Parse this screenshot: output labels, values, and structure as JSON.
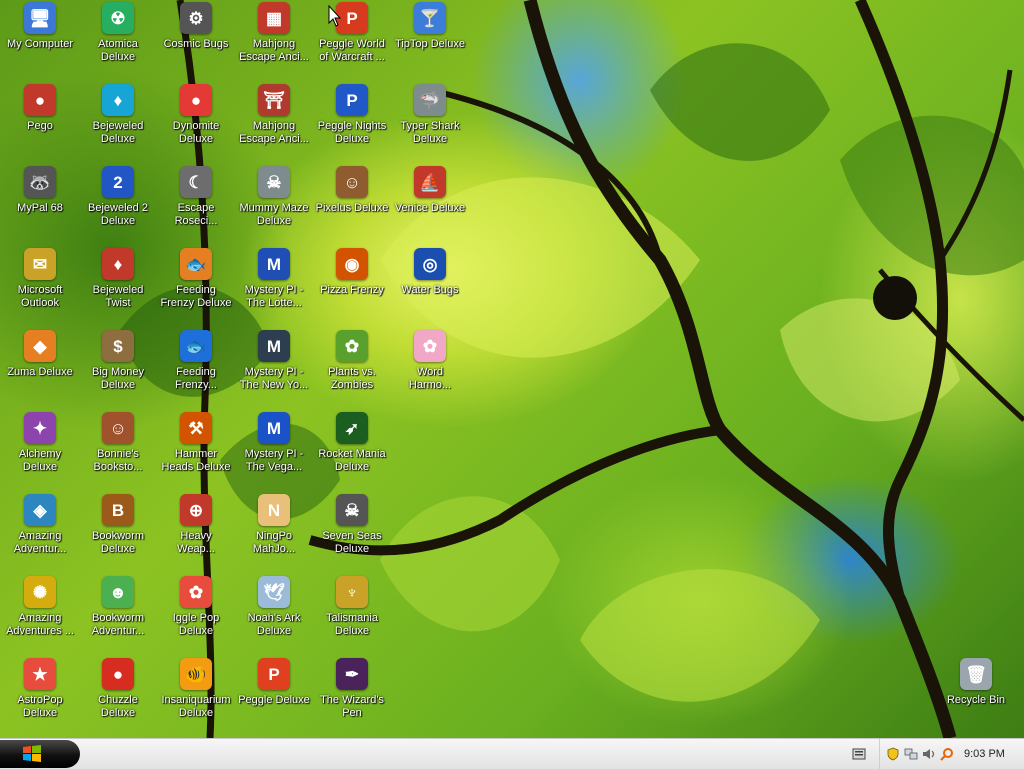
{
  "desktop": {
    "icons": [
      {
        "label": "My Computer",
        "name": "my-computer-icon",
        "color": "#3c78d8",
        "glyph": "🖥"
      },
      {
        "label": "Pego",
        "name": "pego-icon",
        "color": "#c0392b",
        "glyph": "●"
      },
      {
        "label": "MyPal 68",
        "name": "mypal-icon",
        "color": "#555555",
        "glyph": "🦝"
      },
      {
        "label": "Microsoft\nOutlook",
        "name": "outlook-icon",
        "color": "#c9a227",
        "glyph": "✉"
      },
      {
        "label": "Zuma Deluxe",
        "name": "zuma-icon",
        "color": "#e67e22",
        "glyph": "◆"
      },
      {
        "label": "Alchemy\nDeluxe",
        "name": "alchemy-icon",
        "color": "#8e44ad",
        "glyph": "✦"
      },
      {
        "label": "Amazing\nAdventur...",
        "name": "amazing-adventures-1-icon",
        "color": "#2e86c1",
        "glyph": "◈"
      },
      {
        "label": "Amazing\nAdventures ...",
        "name": "amazing-adventures-2-icon",
        "color": "#d4ac0d",
        "glyph": "✺"
      },
      {
        "label": "AstroPop\nDeluxe",
        "name": "astropop-icon",
        "color": "#e74c3c",
        "glyph": "★"
      },
      {
        "label": "Atomica\nDeluxe",
        "name": "atomica-icon",
        "color": "#27ae60",
        "glyph": "☢"
      },
      {
        "label": "Bejeweled\nDeluxe",
        "name": "bejeweled-icon",
        "color": "#17a5d6",
        "glyph": "♦"
      },
      {
        "label": "Bejeweled 2\nDeluxe",
        "name": "bejeweled-2-icon",
        "color": "#2256c4",
        "glyph": "2"
      },
      {
        "label": "Bejeweled\nTwist",
        "name": "bejeweled-twist-icon",
        "color": "#c0392b",
        "glyph": "♦"
      },
      {
        "label": "Big Money\nDeluxe",
        "name": "big-money-icon",
        "color": "#8d6e3f",
        "glyph": "$"
      },
      {
        "label": "Bonnie's\nBooksto...",
        "name": "bonnies-bookstore-icon",
        "color": "#a0522d",
        "glyph": "☺"
      },
      {
        "label": "Bookworm\nDeluxe",
        "name": "bookworm-icon",
        "color": "#9c5a1a",
        "glyph": "B"
      },
      {
        "label": "Bookworm\nAdventur...",
        "name": "bookworm-adventures-icon",
        "color": "#4caf50",
        "glyph": "☻"
      },
      {
        "label": "Chuzzle\nDeluxe",
        "name": "chuzzle-icon",
        "color": "#d62d20",
        "glyph": "●"
      },
      {
        "label": "Cosmic Bugs",
        "name": "cosmic-bugs-icon",
        "color": "#555555",
        "glyph": "⚙"
      },
      {
        "label": "Dynomite\nDeluxe",
        "name": "dynomite-icon",
        "color": "#e53935",
        "glyph": "●"
      },
      {
        "label": "Escape\nRoseci...",
        "name": "escape-rosecliff-icon",
        "color": "#6d6d6d",
        "glyph": "☾"
      },
      {
        "label": "Feeding\nFrenzy Deluxe",
        "name": "feeding-frenzy-icon",
        "color": "#e67e22",
        "glyph": "🐟"
      },
      {
        "label": "Feeding\nFrenzy...",
        "name": "feeding-frenzy-2-icon",
        "color": "#1e6fd9",
        "glyph": "🐟"
      },
      {
        "label": "Hammer\nHeads Deluxe",
        "name": "hammer-heads-icon",
        "color": "#d35400",
        "glyph": "⚒"
      },
      {
        "label": "Heavy\nWeap...",
        "name": "heavy-weapon-icon",
        "color": "#c0392b",
        "glyph": "⊕"
      },
      {
        "label": "Iggle Pop\nDeluxe",
        "name": "iggle-pop-icon",
        "color": "#e74c3c",
        "glyph": "✿"
      },
      {
        "label": "Insaniquarium\nDeluxe",
        "name": "insaniquarium-icon",
        "color": "#f39c12",
        "glyph": "🐠"
      },
      {
        "label": "Mahjong\nEscape Anci...",
        "name": "mahjong-escape-1-icon",
        "color": "#c0392b",
        "glyph": "▦"
      },
      {
        "label": "Mahjong\nEscape Anci...",
        "name": "mahjong-escape-2-icon",
        "color": "#b03a2e",
        "glyph": "⛩"
      },
      {
        "label": "Mummy Maze\nDeluxe",
        "name": "mummy-maze-icon",
        "color": "#7f8c8d",
        "glyph": "☠"
      },
      {
        "label": "Mystery PI -\nThe Lotte...",
        "name": "mystery-pi-lottery-icon",
        "color": "#1f4fb4",
        "glyph": "M"
      },
      {
        "label": "Mystery PI -\nThe New Yo...",
        "name": "mystery-pi-new-york-icon",
        "color": "#2c3e50",
        "glyph": "M"
      },
      {
        "label": "Mystery PI -\nThe Vega...",
        "name": "mystery-pi-vegas-icon",
        "color": "#1a52c7",
        "glyph": "M"
      },
      {
        "label": "NingPo\nMahJo...",
        "name": "ningpo-mahjong-icon",
        "color": "#e8c07a",
        "glyph": "N"
      },
      {
        "label": "Noah's Ark\nDeluxe",
        "name": "noahs-ark-icon",
        "color": "#9bbbd9",
        "glyph": "🕊"
      },
      {
        "label": "Peggle Deluxe",
        "name": "peggle-icon",
        "color": "#e04020",
        "glyph": "P"
      },
      {
        "label": "Peggle World\nof Warcraft ...",
        "name": "peggle-wow-icon",
        "color": "#d63a1f",
        "glyph": "P"
      },
      {
        "label": "Peggle Nights\nDeluxe",
        "name": "peggle-nights-icon",
        "color": "#2058c8",
        "glyph": "P"
      },
      {
        "label": "Pixelus Deluxe",
        "name": "pixelus-icon",
        "color": "#8e5c2f",
        "glyph": "☺"
      },
      {
        "label": "Pizza Frenzy",
        "name": "pizza-frenzy-icon",
        "color": "#d35400",
        "glyph": "◉"
      },
      {
        "label": "Plants vs.\nZombies",
        "name": "plants-vs-zombies-icon",
        "color": "#5aa02c",
        "glyph": "✿"
      },
      {
        "label": "Rocket Mania\nDeluxe",
        "name": "rocket-mania-icon",
        "color": "#1b5e20",
        "glyph": "➶"
      },
      {
        "label": "Seven Seas\nDeluxe",
        "name": "seven-seas-icon",
        "color": "#555555",
        "glyph": "☠"
      },
      {
        "label": "Talismania\nDeluxe",
        "name": "talismania-icon",
        "color": "#c9a227",
        "glyph": "♆"
      },
      {
        "label": "The Wizard's\nPen",
        "name": "wizards-pen-icon",
        "color": "#4a235a",
        "glyph": "✒"
      },
      {
        "label": "TipTop Deluxe",
        "name": "tiptop-icon",
        "color": "#3b7dd8",
        "glyph": "🍸"
      },
      {
        "label": "Typer Shark\nDeluxe",
        "name": "typer-shark-icon",
        "color": "#7f8c8d",
        "glyph": "🦈"
      },
      {
        "label": "Venice Deluxe",
        "name": "venice-icon",
        "color": "#c0392b",
        "glyph": "⛵"
      },
      {
        "label": "Water Bugs",
        "name": "water-bugs-icon",
        "color": "#1a4fb0",
        "glyph": "◎"
      },
      {
        "label": "Word\nHarmo...",
        "name": "word-harmony-icon",
        "color": "#f1a7c6",
        "glyph": "✿"
      },
      {
        "label": "Recycle Bin",
        "name": "recycle-bin-icon",
        "color": "#9aa5ad",
        "glyph": "🗑"
      }
    ]
  },
  "taskbar": {
    "clock": "9:03 PM"
  }
}
